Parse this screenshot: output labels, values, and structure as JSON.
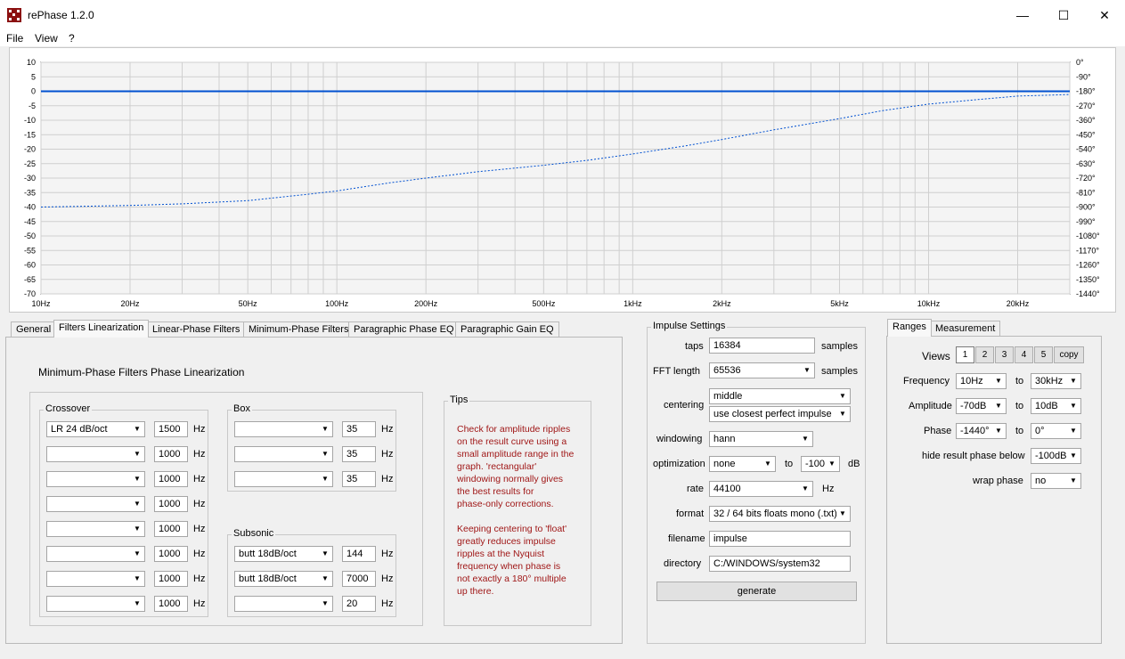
{
  "window": {
    "title": "rePhase 1.2.0",
    "minimize": "—",
    "maximize": "☐",
    "close": "✕"
  },
  "menu": [
    "File",
    "View",
    "?"
  ],
  "graph": {
    "db_ticks": [
      "10",
      "5",
      "0",
      "-5",
      "-10",
      "-15",
      "-20",
      "-25",
      "-30",
      "-35",
      "-40",
      "-45",
      "-50",
      "-55",
      "-60",
      "-65",
      "-70"
    ],
    "phase_ticks": [
      "0°",
      "-90°",
      "-180°",
      "-270°",
      "-360°",
      "-450°",
      "-540°",
      "-630°",
      "-720°",
      "-810°",
      "-900°",
      "-990°",
      "-1080°",
      "-1170°",
      "-1260°",
      "-1350°",
      "-1440°"
    ],
    "freq_ticks": [
      {
        "label": "10Hz",
        "hz": 10
      },
      {
        "label": "20Hz",
        "hz": 20
      },
      {
        "label": "50Hz",
        "hz": 50
      },
      {
        "label": "100Hz",
        "hz": 100
      },
      {
        "label": "200Hz",
        "hz": 200
      },
      {
        "label": "500Hz",
        "hz": 500
      },
      {
        "label": "1kHz",
        "hz": 1000
      },
      {
        "label": "2kHz",
        "hz": 2000
      },
      {
        "label": "5kHz",
        "hz": 5000
      },
      {
        "label": "10kHz",
        "hz": 10000
      },
      {
        "label": "20kHz",
        "hz": 20000
      }
    ],
    "x_range_hz": [
      10,
      30000
    ],
    "db_range": [
      -70,
      10
    ],
    "phase_range_deg": [
      -1440,
      0
    ],
    "amplitude_db": 0,
    "phase_curve": [
      [
        10,
        -900
      ],
      [
        20,
        -890
      ],
      [
        30,
        -880
      ],
      [
        50,
        -860
      ],
      [
        80,
        -820
      ],
      [
        100,
        -800
      ],
      [
        150,
        -750
      ],
      [
        200,
        -720
      ],
      [
        300,
        -680
      ],
      [
        500,
        -640
      ],
      [
        700,
        -610
      ],
      [
        1000,
        -570
      ],
      [
        1500,
        -520
      ],
      [
        2000,
        -480
      ],
      [
        3000,
        -420
      ],
      [
        5000,
        -350
      ],
      [
        7000,
        -300
      ],
      [
        10000,
        -260
      ],
      [
        15000,
        -230
      ],
      [
        20000,
        -210
      ],
      [
        30000,
        -200
      ]
    ],
    "colors": {
      "amplitude": "#0050d0",
      "phase": "#0050d0",
      "grid": "#cfcfcf",
      "plot_bg": "#f4f4f4"
    }
  },
  "tabs": [
    "General",
    "Filters Linearization",
    "Linear-Phase Filters",
    "Minimum-Phase Filters",
    "Paragraphic Phase EQ",
    "Paragraphic Gain EQ"
  ],
  "filters": {
    "heading": "Minimum-Phase Filters Phase Linearization",
    "hz": "Hz",
    "crossover": {
      "label": "Crossover",
      "rows": [
        {
          "type": "LR  24 dB/oct",
          "freq": "1500"
        },
        {
          "type": "",
          "freq": "1000"
        },
        {
          "type": "",
          "freq": "1000"
        },
        {
          "type": "",
          "freq": "1000"
        },
        {
          "type": "",
          "freq": "1000"
        },
        {
          "type": "",
          "freq": "1000"
        },
        {
          "type": "",
          "freq": "1000"
        },
        {
          "type": "",
          "freq": "1000"
        }
      ]
    },
    "box": {
      "label": "Box",
      "rows": [
        {
          "type": "",
          "freq": "35"
        },
        {
          "type": "",
          "freq": "35"
        },
        {
          "type": "",
          "freq": "35"
        }
      ]
    },
    "subsonic": {
      "label": "Subsonic",
      "rows": [
        {
          "type": "butt 18dB/oct",
          "freq": "144"
        },
        {
          "type": "butt 18dB/oct",
          "freq": "7000"
        },
        {
          "type": "",
          "freq": "20"
        }
      ]
    },
    "tips": {
      "label": "Tips",
      "p1": [
        "Check for amplitude ripples",
        "on the result curve using a",
        "small amplitude range in the",
        "graph. 'rectangular'",
        "windowing normally gives",
        "the best results for",
        "phase-only corrections."
      ],
      "p2": [
        "Keeping centering to 'float'",
        "greatly reduces impulse",
        "ripples at the Nyquist",
        "frequency when phase is",
        "not exactly a 180° multiple",
        "up there."
      ]
    }
  },
  "impulse": {
    "label": "Impulse Settings",
    "taps_label": "taps",
    "taps": "16384",
    "samples": "samples",
    "fft_label": "FFT length",
    "fft": "65536",
    "centering_label": "centering",
    "centering": "middle",
    "centering2": "use closest perfect impulse",
    "windowing_label": "windowing",
    "windowing": "hann",
    "optimization_label": "optimization",
    "optimization": "none",
    "to": "to",
    "opt_level": "-100",
    "db": "dB",
    "rate_label": "rate",
    "rate": "44100",
    "hz": "Hz",
    "format_label": "format",
    "format": "32 / 64 bits floats mono (.txt)",
    "filename_label": "filename",
    "filename": "impulse",
    "directory_label": "directory",
    "directory": "C:/WINDOWS/system32",
    "generate": "generate"
  },
  "ranges": {
    "tabs": [
      "Ranges",
      "Measurement"
    ],
    "views_label": "Views",
    "views": [
      "1",
      "2",
      "3",
      "4",
      "5"
    ],
    "copy": "copy",
    "to": "to",
    "frequency_label": "Frequency",
    "freq_from": "10Hz",
    "freq_to": "30kHz",
    "amplitude_label": "Amplitude",
    "amp_from": "-70dB",
    "amp_to": "10dB",
    "phase_label": "Phase",
    "phase_from": "-1440°",
    "phase_to": "0°",
    "hide_label": "hide result phase below",
    "hide_value": "-100dB",
    "wrap_label": "wrap phase",
    "wrap_value": "no"
  }
}
